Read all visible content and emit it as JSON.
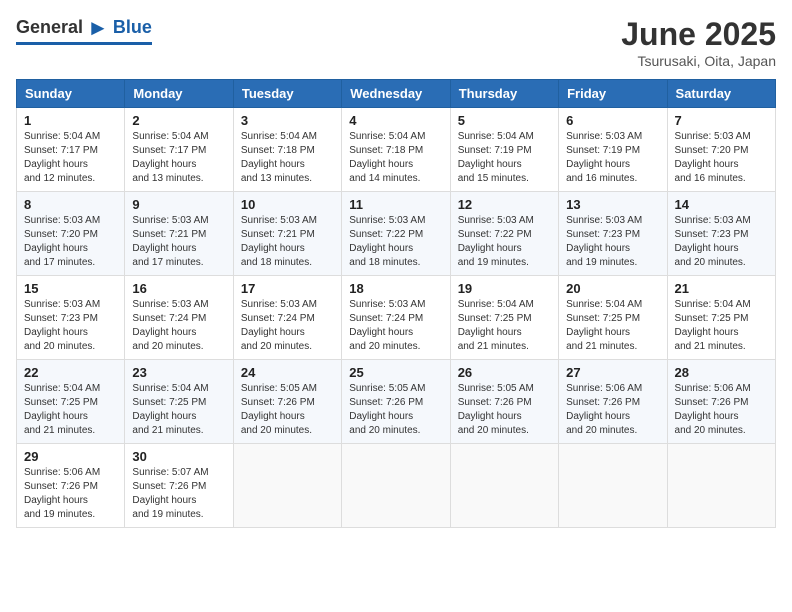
{
  "logo": {
    "general": "General",
    "blue": "Blue"
  },
  "title": "June 2025",
  "location": "Tsurusaki, Oita, Japan",
  "days": [
    "Sunday",
    "Monday",
    "Tuesday",
    "Wednesday",
    "Thursday",
    "Friday",
    "Saturday"
  ],
  "weeks": [
    [
      {
        "day": "1",
        "sunrise": "5:04 AM",
        "sunset": "7:17 PM",
        "daylight": "14 hours and 12 minutes."
      },
      {
        "day": "2",
        "sunrise": "5:04 AM",
        "sunset": "7:17 PM",
        "daylight": "14 hours and 13 minutes."
      },
      {
        "day": "3",
        "sunrise": "5:04 AM",
        "sunset": "7:18 PM",
        "daylight": "14 hours and 13 minutes."
      },
      {
        "day": "4",
        "sunrise": "5:04 AM",
        "sunset": "7:18 PM",
        "daylight": "14 hours and 14 minutes."
      },
      {
        "day": "5",
        "sunrise": "5:04 AM",
        "sunset": "7:19 PM",
        "daylight": "14 hours and 15 minutes."
      },
      {
        "day": "6",
        "sunrise": "5:03 AM",
        "sunset": "7:19 PM",
        "daylight": "14 hours and 16 minutes."
      },
      {
        "day": "7",
        "sunrise": "5:03 AM",
        "sunset": "7:20 PM",
        "daylight": "14 hours and 16 minutes."
      }
    ],
    [
      {
        "day": "8",
        "sunrise": "5:03 AM",
        "sunset": "7:20 PM",
        "daylight": "14 hours and 17 minutes."
      },
      {
        "day": "9",
        "sunrise": "5:03 AM",
        "sunset": "7:21 PM",
        "daylight": "14 hours and 17 minutes."
      },
      {
        "day": "10",
        "sunrise": "5:03 AM",
        "sunset": "7:21 PM",
        "daylight": "14 hours and 18 minutes."
      },
      {
        "day": "11",
        "sunrise": "5:03 AM",
        "sunset": "7:22 PM",
        "daylight": "14 hours and 18 minutes."
      },
      {
        "day": "12",
        "sunrise": "5:03 AM",
        "sunset": "7:22 PM",
        "daylight": "14 hours and 19 minutes."
      },
      {
        "day": "13",
        "sunrise": "5:03 AM",
        "sunset": "7:23 PM",
        "daylight": "14 hours and 19 minutes."
      },
      {
        "day": "14",
        "sunrise": "5:03 AM",
        "sunset": "7:23 PM",
        "daylight": "14 hours and 20 minutes."
      }
    ],
    [
      {
        "day": "15",
        "sunrise": "5:03 AM",
        "sunset": "7:23 PM",
        "daylight": "14 hours and 20 minutes."
      },
      {
        "day": "16",
        "sunrise": "5:03 AM",
        "sunset": "7:24 PM",
        "daylight": "14 hours and 20 minutes."
      },
      {
        "day": "17",
        "sunrise": "5:03 AM",
        "sunset": "7:24 PM",
        "daylight": "14 hours and 20 minutes."
      },
      {
        "day": "18",
        "sunrise": "5:03 AM",
        "sunset": "7:24 PM",
        "daylight": "14 hours and 20 minutes."
      },
      {
        "day": "19",
        "sunrise": "5:04 AM",
        "sunset": "7:25 PM",
        "daylight": "14 hours and 21 minutes."
      },
      {
        "day": "20",
        "sunrise": "5:04 AM",
        "sunset": "7:25 PM",
        "daylight": "14 hours and 21 minutes."
      },
      {
        "day": "21",
        "sunrise": "5:04 AM",
        "sunset": "7:25 PM",
        "daylight": "14 hours and 21 minutes."
      }
    ],
    [
      {
        "day": "22",
        "sunrise": "5:04 AM",
        "sunset": "7:25 PM",
        "daylight": "14 hours and 21 minutes."
      },
      {
        "day": "23",
        "sunrise": "5:04 AM",
        "sunset": "7:25 PM",
        "daylight": "14 hours and 21 minutes."
      },
      {
        "day": "24",
        "sunrise": "5:05 AM",
        "sunset": "7:26 PM",
        "daylight": "14 hours and 20 minutes."
      },
      {
        "day": "25",
        "sunrise": "5:05 AM",
        "sunset": "7:26 PM",
        "daylight": "14 hours and 20 minutes."
      },
      {
        "day": "26",
        "sunrise": "5:05 AM",
        "sunset": "7:26 PM",
        "daylight": "14 hours and 20 minutes."
      },
      {
        "day": "27",
        "sunrise": "5:06 AM",
        "sunset": "7:26 PM",
        "daylight": "14 hours and 20 minutes."
      },
      {
        "day": "28",
        "sunrise": "5:06 AM",
        "sunset": "7:26 PM",
        "daylight": "14 hours and 20 minutes."
      }
    ],
    [
      {
        "day": "29",
        "sunrise": "5:06 AM",
        "sunset": "7:26 PM",
        "daylight": "14 hours and 19 minutes."
      },
      {
        "day": "30",
        "sunrise": "5:07 AM",
        "sunset": "7:26 PM",
        "daylight": "14 hours and 19 minutes."
      },
      null,
      null,
      null,
      null,
      null
    ]
  ],
  "labels": {
    "sunrise": "Sunrise:",
    "sunset": "Sunset:",
    "daylight": "Daylight hours"
  }
}
